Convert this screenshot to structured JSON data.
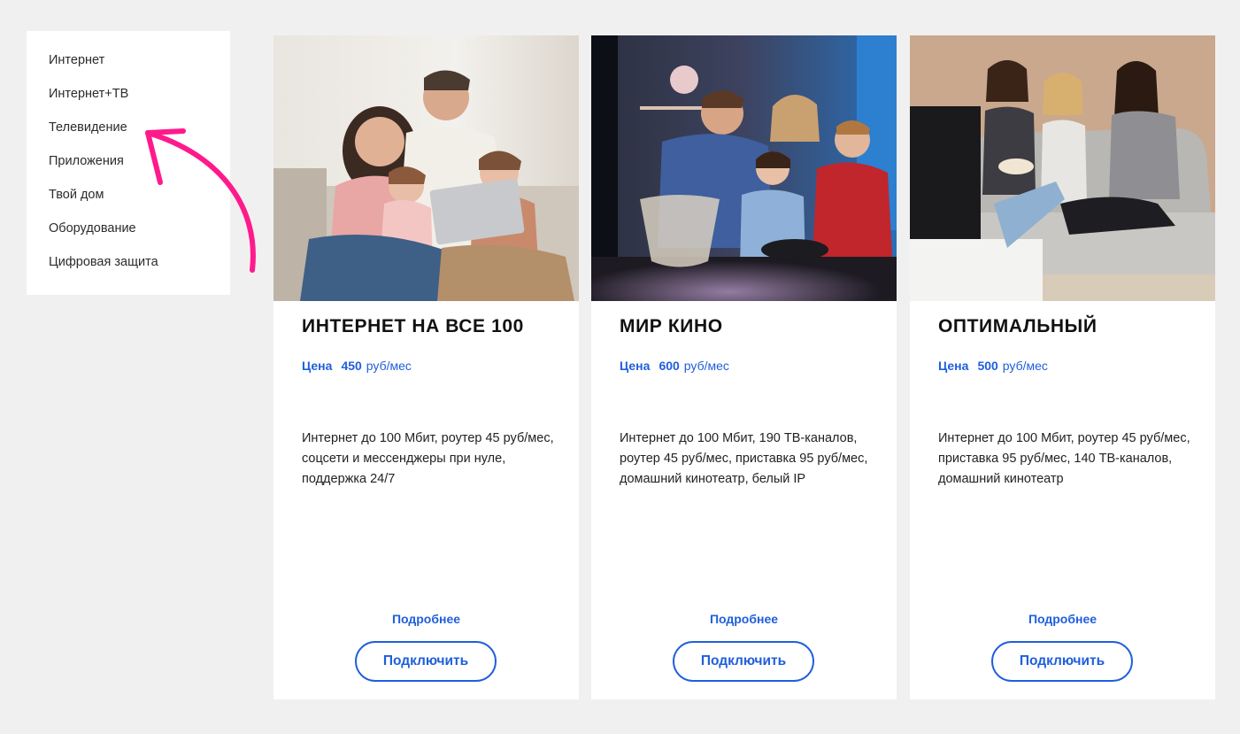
{
  "sidebar": {
    "items": [
      {
        "label": "Интернет"
      },
      {
        "label": "Интернет+ТВ"
      },
      {
        "label": "Телевидение"
      },
      {
        "label": "Приложения"
      },
      {
        "label": "Твой дом"
      },
      {
        "label": "Оборудование"
      },
      {
        "label": "Цифровая защита"
      }
    ]
  },
  "annotation": {
    "arrow_color": "#ff1a8c",
    "points_to": "Телевидение"
  },
  "colors": {
    "accent": "#1f5fdc",
    "background": "#f0f0f0",
    "card": "#ffffff"
  },
  "cards": [
    {
      "image": "family-with-laptop-photo",
      "title": "ИНТЕРНЕТ НА ВСЕ 100",
      "price_label": "Цена",
      "price_value": "450",
      "price_unit": "руб/мес",
      "description": "Интернет до 100 Мбит, роутер 45 руб/мес, соцсети и мессенджеры при нуле, поддержка 24/7",
      "details_label": "Подробнее",
      "connect_label": "Подключить"
    },
    {
      "image": "family-watching-tv-photo",
      "title": "МИР КИНО",
      "price_label": "Цена",
      "price_value": "600",
      "price_unit": "руб/мес",
      "description": "Интернет до 100 Мбит, 190 ТВ-каналов, роутер 45 руб/мес, приставка 95 руб/мес, домашний кинотеатр, белый IP",
      "details_label": "Подробнее",
      "connect_label": "Подключить"
    },
    {
      "image": "friends-on-sofa-photo",
      "title": "ОПТИМАЛЬНЫЙ",
      "price_label": "Цена",
      "price_value": "500",
      "price_unit": "руб/мес",
      "description": "Интернет до 100 Мбит, роутер 45 руб/мес, приставка 95 руб/мес, 140 ТВ-каналов, домашний кинотеатр",
      "details_label": "Подробнее",
      "connect_label": "Подключить"
    }
  ]
}
